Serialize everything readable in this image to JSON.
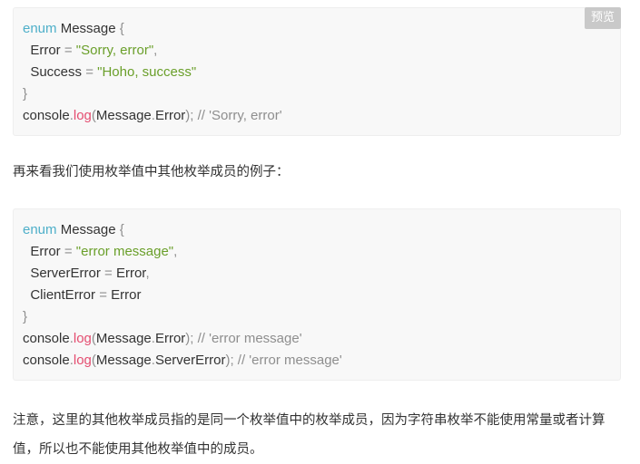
{
  "code_block_1": {
    "preview_label": "预览",
    "lines": [
      [
        {
          "t": "enum",
          "c": "kw"
        },
        {
          "t": " Message ",
          "c": ""
        },
        {
          "t": "{",
          "c": "punct"
        }
      ],
      [
        {
          "t": "  Error ",
          "c": ""
        },
        {
          "t": "=",
          "c": "punct"
        },
        {
          "t": " ",
          "c": ""
        },
        {
          "t": "\"Sorry, error\"",
          "c": "str"
        },
        {
          "t": ",",
          "c": "punct"
        }
      ],
      [
        {
          "t": "  Success ",
          "c": ""
        },
        {
          "t": "=",
          "c": "punct"
        },
        {
          "t": " ",
          "c": ""
        },
        {
          "t": "\"Hoho, success\"",
          "c": "str"
        }
      ],
      [
        {
          "t": "}",
          "c": "punct"
        }
      ],
      [
        {
          "t": "console",
          "c": ""
        },
        {
          "t": ".",
          "c": "punct"
        },
        {
          "t": "log",
          "c": "fn"
        },
        {
          "t": "(",
          "c": "punct"
        },
        {
          "t": "Message",
          "c": ""
        },
        {
          "t": ".",
          "c": "punct"
        },
        {
          "t": "Error",
          "c": ""
        },
        {
          "t": ");",
          "c": "punct"
        },
        {
          "t": " // 'Sorry, error'",
          "c": "cmt"
        }
      ]
    ]
  },
  "paragraph_1": "再来看我们使用枚举值中其他枚举成员的例子：",
  "code_block_2": {
    "lines": [
      [
        {
          "t": "enum",
          "c": "kw"
        },
        {
          "t": " Message ",
          "c": ""
        },
        {
          "t": "{",
          "c": "punct"
        }
      ],
      [
        {
          "t": "  Error ",
          "c": ""
        },
        {
          "t": "=",
          "c": "punct"
        },
        {
          "t": " ",
          "c": ""
        },
        {
          "t": "\"error message\"",
          "c": "str"
        },
        {
          "t": ",",
          "c": "punct"
        }
      ],
      [
        {
          "t": "  ServerError ",
          "c": ""
        },
        {
          "t": "=",
          "c": "punct"
        },
        {
          "t": " Error",
          "c": ""
        },
        {
          "t": ",",
          "c": "punct"
        }
      ],
      [
        {
          "t": "  ClientError ",
          "c": ""
        },
        {
          "t": "=",
          "c": "punct"
        },
        {
          "t": " Error",
          "c": ""
        }
      ],
      [
        {
          "t": "}",
          "c": "punct"
        }
      ],
      [
        {
          "t": "console",
          "c": ""
        },
        {
          "t": ".",
          "c": "punct"
        },
        {
          "t": "log",
          "c": "fn"
        },
        {
          "t": "(",
          "c": "punct"
        },
        {
          "t": "Message",
          "c": ""
        },
        {
          "t": ".",
          "c": "punct"
        },
        {
          "t": "Error",
          "c": ""
        },
        {
          "t": ");",
          "c": "punct"
        },
        {
          "t": " // 'error message'",
          "c": "cmt"
        }
      ],
      [
        {
          "t": "console",
          "c": ""
        },
        {
          "t": ".",
          "c": "punct"
        },
        {
          "t": "log",
          "c": "fn"
        },
        {
          "t": "(",
          "c": "punct"
        },
        {
          "t": "Message",
          "c": ""
        },
        {
          "t": ".",
          "c": "punct"
        },
        {
          "t": "ServerError",
          "c": ""
        },
        {
          "t": ");",
          "c": "punct"
        },
        {
          "t": " // 'error message'",
          "c": "cmt"
        }
      ]
    ]
  },
  "paragraph_2": "注意，这里的其他枚举成员指的是同一个枚举值中的枚举成员，因为字符串枚举不能使用常量或者计算值，所以也不能使用其他枚举值中的成员。",
  "colors": {
    "keyword": "#4eafc9",
    "string": "#6a9f2a",
    "function": "#e44d70",
    "punctuation": "#8e8e8e",
    "code_background": "#f8f8f8",
    "preview_button_background": "#c9c9c9"
  }
}
